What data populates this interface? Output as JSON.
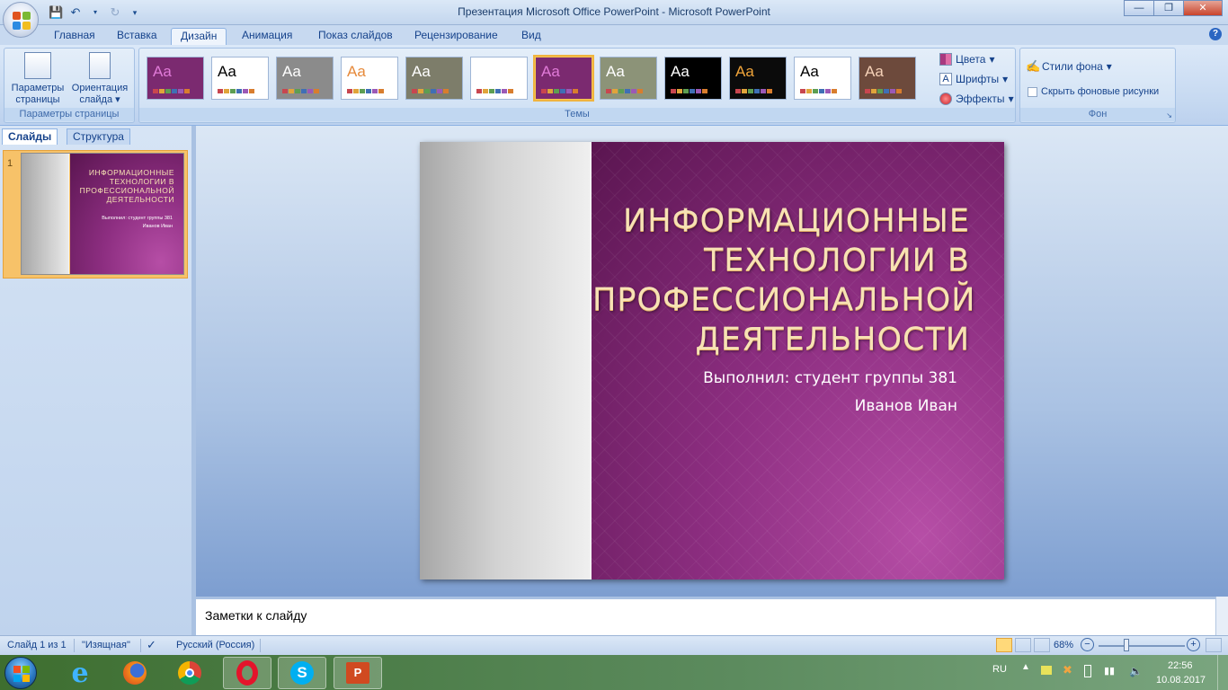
{
  "app": {
    "title": "Презентация Microsoft Office PowerPoint - Microsoft PowerPoint"
  },
  "ribbon": {
    "tabs": [
      "Главная",
      "Вставка",
      "Дизайн",
      "Анимация",
      "Показ слайдов",
      "Рецензирование",
      "Вид"
    ],
    "active_tab": "Дизайн",
    "page_setup": {
      "button1": "Параметры страницы",
      "button2": "Ориентация слайда",
      "group_label": "Параметры страницы"
    },
    "themes": {
      "group_label": "Темы",
      "sample_text": "Aa",
      "selected_index": 6,
      "items": [
        {
          "bg": "#7b2a70",
          "fg": "#e07ad8"
        },
        {
          "bg": "#ffffff",
          "fg": "#000000"
        },
        {
          "bg": "#8b8b8b",
          "fg": "#ffffff"
        },
        {
          "bg": "#ffffff",
          "fg": "#e68a3b"
        },
        {
          "bg": "#7d7d6a",
          "fg": "#ffffff"
        },
        {
          "bg": "#ffffff",
          "fg": "#ffffff"
        },
        {
          "bg": "#7b2a70",
          "fg": "#e07ad8"
        },
        {
          "bg": "#8c9378",
          "fg": "#ffffff"
        },
        {
          "bg": "#000000",
          "fg": "#ffffff"
        },
        {
          "bg": "#0b0b0b",
          "fg": "#f0a43a"
        },
        {
          "bg": "#ffffff",
          "fg": "#000000"
        },
        {
          "bg": "#6d4a3c",
          "fg": "#f6d2b8"
        }
      ],
      "colors_label": "Цвета",
      "fonts_label": "Шрифты",
      "effects_label": "Эффекты"
    },
    "background": {
      "styles_label": "Стили фона",
      "hide_label": "Скрыть фоновые рисунки",
      "group_label": "Фон"
    }
  },
  "left_pane": {
    "tab_slides": "Слайды",
    "tab_outline": "Структура",
    "slide_number": "1"
  },
  "slide": {
    "title": "ИНФОРМАЦИОННЫЕ ТЕХНОЛОГИИ В ПРОФЕССИОНАЛЬНОЙ ДЕЯТЕЛЬНОСТИ",
    "subtitle_line1": "Выполнил: студент группы 381",
    "subtitle_line2": "Иванов Иван"
  },
  "notes": {
    "placeholder": "Заметки к слайду"
  },
  "status_bar": {
    "slide_info": "Слайд 1 из 1",
    "theme_name": "\"Изящная\"",
    "language": "Русский (Россия)",
    "zoom": "68%",
    "zoom_value": 68
  },
  "taskbar": {
    "lang": "RU",
    "time": "22:56",
    "date": "10.08.2017"
  }
}
